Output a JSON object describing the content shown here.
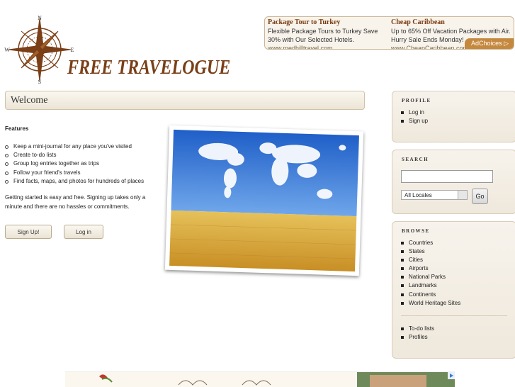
{
  "logo": {
    "text": "FREE TRAVELOGUE",
    "compass": {
      "n": "N",
      "s": "S",
      "e": "E",
      "w": "W"
    }
  },
  "ads": {
    "ad1": {
      "title": "Package Tour to Turkey",
      "body": "Flexible Package Tours to Turkey Save 30% with Our Selected Hotels.",
      "url": "www.medhilltravel.com"
    },
    "ad2": {
      "title": "Cheap Caribbean",
      "body": "Up to 65% Off Vacation Packages with Air. Hurry Sale Ends Monday!",
      "url": "www.CheapCaribbean.com"
    },
    "adchoices": "AdChoices ▷"
  },
  "welcome": {
    "title": "Welcome"
  },
  "features": {
    "heading": "Features",
    "items": [
      "Keep a mini-journal for any place you've visited",
      "Create to-do lists",
      "Group log entries together as trips",
      "Follow your friend's travels",
      "Find facts, maps, and photos for hundreds of places"
    ],
    "intro": "Getting started is easy and free. Signing up takes only a minute and there are no hassles or commitments."
  },
  "buttons": {
    "signup": "Sign Up!",
    "login": "Log in"
  },
  "sidebar": {
    "profile": {
      "title": "PROFILE",
      "items": [
        "Log in",
        "Sign up"
      ]
    },
    "search": {
      "title": "SEARCH",
      "select_value": "All Locales",
      "go": "Go"
    },
    "browse": {
      "title": "BROWSE",
      "items": [
        "Countries",
        "States",
        "Cities",
        "Airports",
        "National Parks",
        "Landmarks",
        "Continents",
        "World Heritage Sites"
      ],
      "extra_items": [
        "To-do lists",
        "Profiles"
      ]
    }
  },
  "colors": {
    "brand": "#7a3f17",
    "ad_title": "#7a3a10",
    "adchoices_bg": "#c5883f",
    "sky": "#2f6fd6",
    "wheat": "#d9a83a"
  }
}
